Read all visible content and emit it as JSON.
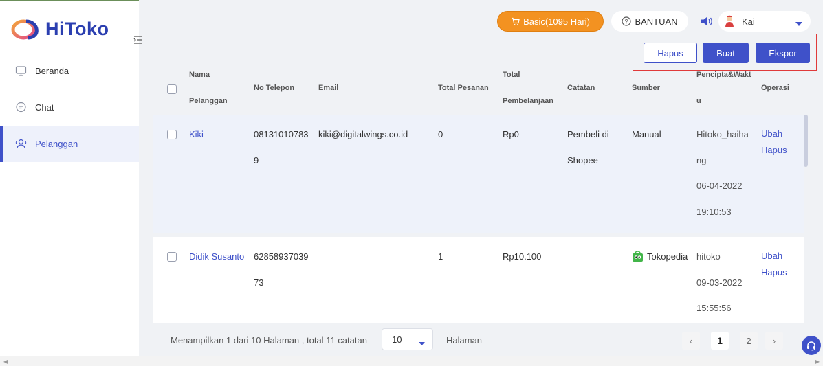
{
  "brand": {
    "name": "HiToko"
  },
  "sidebar": {
    "items": [
      {
        "label": "Beranda",
        "icon": "monitor-icon"
      },
      {
        "label": "Chat",
        "icon": "chat-icon"
      },
      {
        "label": "Pelanggan",
        "icon": "users-icon",
        "active": true
      }
    ]
  },
  "header": {
    "plan_label": "Basic(1095 Hari)",
    "help_label": "BANTUAN",
    "user_name": "Kai"
  },
  "actions": {
    "delete_label": "Hapus",
    "create_label": "Buat",
    "export_label": "Ekspor"
  },
  "table": {
    "headers": {
      "name": [
        "Nama",
        "Pelanggan"
      ],
      "phone": "No Telepon",
      "email": "Email",
      "orders": "Total Pesanan",
      "spend": [
        "Total",
        "Pembelanjaan"
      ],
      "notes": "Catatan",
      "source": "Sumber",
      "creator": [
        "Pencipta&Wakt",
        "u"
      ],
      "ops": "Operasi"
    },
    "rows": [
      {
        "name": "Kiki",
        "phone": [
          "08131010783",
          "9"
        ],
        "email": "kiki@digitalwings.co.id",
        "orders": "0",
        "spend": "Rp0",
        "notes": [
          "Pembeli di",
          "Shopee"
        ],
        "source": "Manual",
        "creator": [
          "Hitoko_haiha",
          "ng",
          "06-04-2022",
          "19:10:53"
        ],
        "edit_label": "Ubah",
        "delete_label": "Hapus"
      },
      {
        "name": "Didik Susanto",
        "phone": [
          "62858937039",
          "73"
        ],
        "email": "",
        "orders": "1",
        "spend": "Rp10.100",
        "notes": [
          "",
          ""
        ],
        "source": "Tokopedia",
        "creator": [
          "hitoko",
          "09-03-2022",
          "15:55:56"
        ],
        "edit_label": "Ubah",
        "delete_label": "Hapus"
      }
    ]
  },
  "footer": {
    "summary": "Menampilkan 1 dari 10 Halaman , total 11 catatan",
    "page_size": "10",
    "page_label": "Halaman",
    "pages": [
      "1",
      "2"
    ],
    "prev": "‹",
    "next": "›"
  },
  "colors": {
    "primary": "#3f51c9",
    "plan": "#f39221",
    "highlight_box": "#e03a3a"
  }
}
